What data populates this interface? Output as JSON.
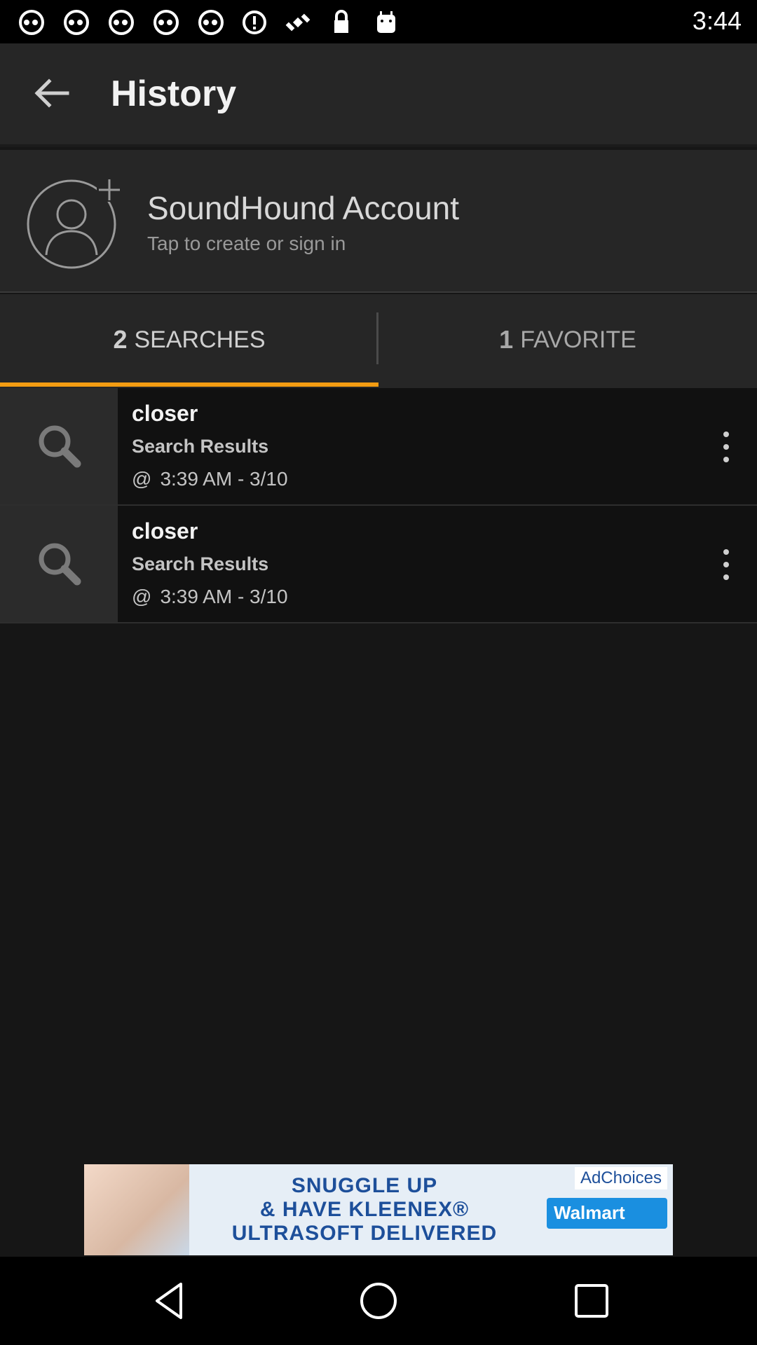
{
  "status_bar": {
    "time": "3:44",
    "icons": [
      "abc7-icon",
      "abc7-icon",
      "abc7-icon",
      "abc7-icon",
      "abc7-icon",
      "alert-icon",
      "satellite-icon",
      "lock-icon",
      "android-icon"
    ]
  },
  "app_bar": {
    "title": "History",
    "back_icon": "arrow-left-icon"
  },
  "account": {
    "title": "SoundHound Account",
    "subtitle": "Tap to create or sign in",
    "icon": "add-user-icon"
  },
  "tabs": [
    {
      "count": "2",
      "label": "SEARCHES",
      "selected": true
    },
    {
      "count": "1",
      "label": "FAVORITE",
      "selected": false
    }
  ],
  "history": [
    {
      "title": "closer",
      "type": "Search Results",
      "at": "@",
      "time": "3:39 AM - 3/10"
    },
    {
      "title": "closer",
      "type": "Search Results",
      "at": "@",
      "time": "3:39 AM - 3/10"
    }
  ],
  "ad": {
    "choices": "AdChoices",
    "line1": "SNUGGLE UP",
    "line2": "& HAVE KLEENEX®",
    "line3": "ULTRASOFT DELIVERED",
    "brand": "Walmart"
  },
  "colors": {
    "accent": "#f39c12",
    "background": "#161616",
    "bar": "#262626"
  }
}
